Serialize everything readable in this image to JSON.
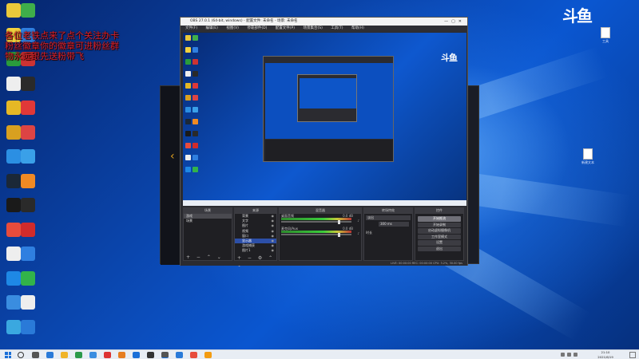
{
  "desktop": {
    "watermark_logo": "斗鱼",
    "overlay_text": "各位老铁点来了点个关注办卡粉丝徽章你的徽章可进粉丝群物永远跟先送粉带飞",
    "icons": [
      {
        "name": "icon-1",
        "label": "",
        "color": "#e9c83a"
      },
      {
        "name": "icon-2",
        "label": "",
        "color": "#3fae4a"
      },
      {
        "name": "icon-3",
        "label": "",
        "color": "#f2d13e"
      },
      {
        "name": "icon-4",
        "label": "",
        "color": "#2f7fe0"
      },
      {
        "name": "icon-5",
        "label": "",
        "color": "#2a9b3c"
      },
      {
        "name": "icon-6",
        "label": "",
        "color": "#c33"
      },
      {
        "name": "icon-7",
        "label": "",
        "color": "#eee"
      },
      {
        "name": "icon-8",
        "label": "",
        "color": "#2a2a2a"
      },
      {
        "name": "icon-9",
        "label": "",
        "color": "#e6b825"
      },
      {
        "name": "icon-10",
        "label": "",
        "color": "#e03838"
      },
      {
        "name": "icon-11",
        "label": "",
        "color": "#d8a020"
      },
      {
        "name": "icon-12",
        "label": "",
        "color": "#d44"
      },
      {
        "name": "icon-13",
        "label": "",
        "color": "#2b8fe3"
      },
      {
        "name": "icon-14",
        "label": "",
        "color": "#3aa0e8"
      },
      {
        "name": "icon-15",
        "label": "",
        "color": "#1b2838"
      },
      {
        "name": "icon-16",
        "label": "",
        "color": "#f08a24"
      },
      {
        "name": "icon-17",
        "label": "",
        "color": "#1a1a1a"
      },
      {
        "name": "icon-18",
        "label": "",
        "color": "#2a2a2a"
      },
      {
        "name": "icon-19",
        "label": "",
        "color": "#e74c3c"
      },
      {
        "name": "icon-20",
        "label": "",
        "color": "#d02b2b"
      },
      {
        "name": "icon-21",
        "label": "",
        "color": "#eee"
      },
      {
        "name": "icon-22",
        "label": "",
        "color": "#2f7fe0"
      },
      {
        "name": "icon-23",
        "label": "",
        "color": "#1e88e5"
      },
      {
        "name": "icon-24",
        "label": "",
        "color": "#32b34a"
      },
      {
        "name": "icon-25",
        "label": "",
        "color": "#3a8de0"
      },
      {
        "name": "icon-26",
        "label": "",
        "color": "#eee"
      },
      {
        "name": "icon-27",
        "label": "",
        "color": "#3aa8e0"
      },
      {
        "name": "icon-28",
        "label": "",
        "color": "#2a7ad8"
      }
    ],
    "right_files": [
      {
        "name": "desktop-file-1",
        "label": "工具"
      },
      {
        "name": "desktop-file-2",
        "label": "新建文本"
      }
    ]
  },
  "obs": {
    "title": "OBS 27.0.1 (64-bit, windows) - 配置文件: 未命名 - 场景: 未命名",
    "menu": [
      "文件(F)",
      "编辑(E)",
      "视图(V)",
      "停靠部件(D)",
      "配置文件(P)",
      "场景集合(S)",
      "工具(T)",
      "帮助(H)"
    ],
    "docks": {
      "scenes_header": "场景",
      "sources_header": "来源",
      "mixer_header": "混音器",
      "transitions_header": "转场特效",
      "controls_header": "控件"
    },
    "scenes": [
      "游戏",
      "场景"
    ],
    "sources": [
      "背景",
      "文字",
      "图片",
      "视频",
      "窗口",
      "显示器",
      "游戏捕获",
      "图片1"
    ],
    "mixer": [
      {
        "name": "桌面音频",
        "db": "0.0 dB",
        "level": 0.82
      },
      {
        "name": "麦克风/Aux",
        "db": "0.0 dB",
        "level": 0.82
      }
    ],
    "transition": {
      "type": "淡出",
      "duration_label": "时长",
      "duration": "300 ms"
    },
    "controls": [
      "开始推流",
      "开始录制",
      "启动虚拟摄像机",
      "工作室模式",
      "设置",
      "退出"
    ],
    "status": "LIVE: 00:00:00   REC: 00:00:00   CPU: 3.2%, 30.00 fps"
  },
  "taskbar": {
    "time": "21:10",
    "date": "2021/6/19"
  }
}
